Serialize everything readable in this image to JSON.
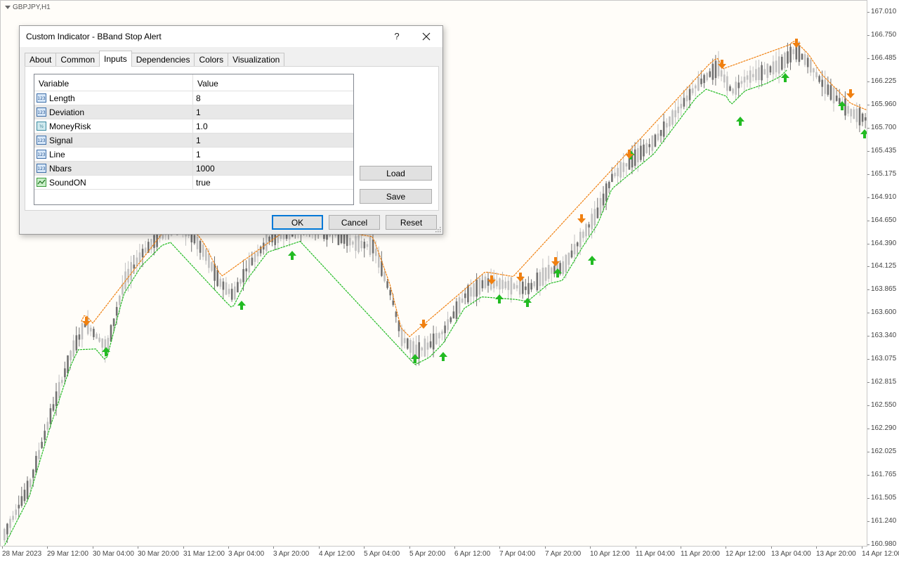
{
  "chart": {
    "symbol": "GBPJPY,H1",
    "price_labels": [
      "167.010",
      "166.750",
      "166.485",
      "166.225",
      "165.960",
      "165.700",
      "165.435",
      "165.175",
      "164.910",
      "164.650",
      "164.390",
      "164.125",
      "163.865",
      "163.600",
      "163.340",
      "163.075",
      "162.815",
      "162.550",
      "162.290",
      "162.025",
      "161.765",
      "161.505",
      "161.240",
      "160.980"
    ],
    "time_labels": [
      "28 Mar 2023",
      "29 Mar 12:00",
      "30 Mar 04:00",
      "30 Mar 20:00",
      "31 Mar 12:00",
      "3 Apr 04:00",
      "3 Apr 20:00",
      "4 Apr 12:00",
      "5 Apr 04:00",
      "5 Apr 20:00",
      "6 Apr 12:00",
      "7 Apr 04:00",
      "7 Apr 20:00",
      "10 Apr 12:00",
      "11 Apr 04:00",
      "11 Apr 20:00",
      "12 Apr 12:00",
      "13 Apr 04:00",
      "13 Apr 20:00",
      "14 Apr 12:00"
    ],
    "colors": {
      "up_line": "#22bb22",
      "down_line": "#f08010",
      "bull_candle": "#c0c0c0",
      "bear_candle": "#707070",
      "background": "#fffdf9"
    }
  },
  "dialog": {
    "title": "Custom Indicator - BBand Stop Alert",
    "help_label": "?",
    "close_icon": "close-icon",
    "tabs": [
      {
        "label": "About"
      },
      {
        "label": "Common"
      },
      {
        "label": "Inputs"
      },
      {
        "label": "Dependencies"
      },
      {
        "label": "Colors"
      },
      {
        "label": "Visualization"
      }
    ],
    "active_tab": "Inputs",
    "table": {
      "header_variable": "Variable",
      "header_value": "Value",
      "rows": [
        {
          "icon": "123",
          "variable": "Length",
          "value": "8"
        },
        {
          "icon": "123",
          "variable": "Deviation",
          "value": "1"
        },
        {
          "icon": "1/2",
          "variable": "MoneyRisk",
          "value": "1.0"
        },
        {
          "icon": "123",
          "variable": "Signal",
          "value": "1"
        },
        {
          "icon": "123",
          "variable": "Line",
          "value": "1"
        },
        {
          "icon": "123",
          "variable": "Nbars",
          "value": "1000"
        },
        {
          "icon": "bool",
          "variable": "SoundON",
          "value": "true"
        }
      ]
    },
    "buttons": {
      "load": "Load",
      "save": "Save",
      "ok": "OK",
      "cancel": "Cancel",
      "reset": "Reset"
    }
  }
}
